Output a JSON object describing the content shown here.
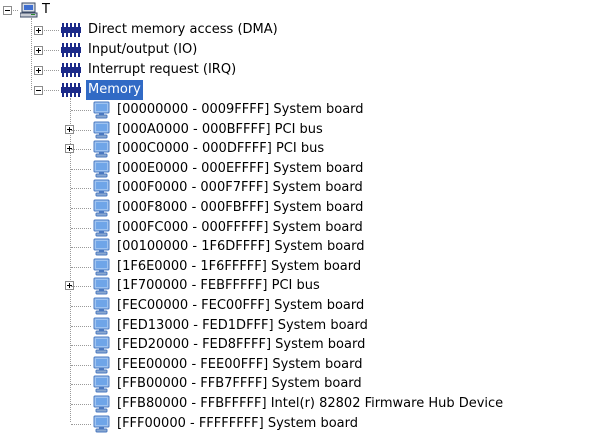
{
  "root": {
    "label": "T",
    "icon": "computer-icon"
  },
  "categories": [
    {
      "label": "Direct memory access (DMA)",
      "expanded": false,
      "icon": "chip-icon"
    },
    {
      "label": "Input/output (IO)",
      "expanded": false,
      "icon": "chip-icon"
    },
    {
      "label": "Interrupt request (IRQ)",
      "expanded": false,
      "icon": "chip-icon"
    },
    {
      "label": "Memory",
      "expanded": true,
      "selected": true,
      "icon": "chip-icon"
    }
  ],
  "memory_items": [
    {
      "label": "[00000000 - 0009FFFF]  System board",
      "has_children": false
    },
    {
      "label": "[000A0000 - 000BFFFF]  PCI bus",
      "has_children": true
    },
    {
      "label": "[000C0000 - 000DFFFF]  PCI bus",
      "has_children": true
    },
    {
      "label": "[000E0000 - 000EFFFF]  System board",
      "has_children": false
    },
    {
      "label": "[000F0000 - 000F7FFF]  System board",
      "has_children": false
    },
    {
      "label": "[000F8000 - 000FBFFF]  System board",
      "has_children": false
    },
    {
      "label": "[000FC000 - 000FFFFF]  System board",
      "has_children": false
    },
    {
      "label": "[00100000 - 1F6DFFFF]  System board",
      "has_children": false
    },
    {
      "label": "[1F6E0000 - 1F6FFFFF]  System board",
      "has_children": false
    },
    {
      "label": "[1F700000 - FEBFFFFF]  PCI bus",
      "has_children": true
    },
    {
      "label": "[FEC00000 - FEC00FFF]  System board",
      "has_children": false
    },
    {
      "label": "[FED13000 - FED1DFFF]  System board",
      "has_children": false
    },
    {
      "label": "[FED20000 - FED8FFFF]  System board",
      "has_children": false
    },
    {
      "label": "[FEE00000 - FEE00FFF]  System board",
      "has_children": false
    },
    {
      "label": "[FFB00000 - FFB7FFFF]  System board",
      "has_children": false
    },
    {
      "label": "[FFB80000 - FFBFFFFF]  Intel(r) 82802 Firmware Hub Device",
      "has_children": false
    },
    {
      "label": "[FFF00000 - FFFFFFFF]  System board",
      "has_children": false
    }
  ],
  "memory_item_icon": "monitor-device-icon"
}
